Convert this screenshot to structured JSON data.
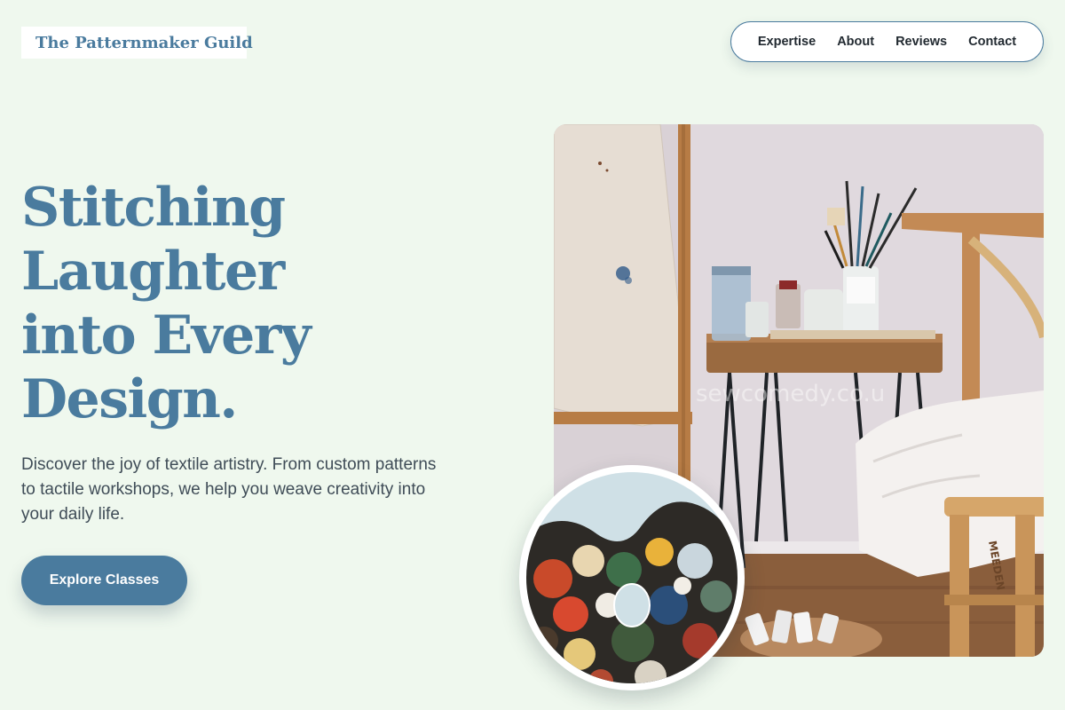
{
  "brand": {
    "name": "The Patternmaker Guild"
  },
  "nav": {
    "items": [
      {
        "label": "Expertise"
      },
      {
        "label": "About"
      },
      {
        "label": "Reviews"
      },
      {
        "label": "Contact"
      }
    ]
  },
  "hero": {
    "title_lines": [
      "Stitching",
      "Laughter",
      "into Every",
      "Design."
    ],
    "description": "Discover the joy of textile artistry. From custom patterns to tactile workshops, we help you weave creativity into your daily life.",
    "cta_label": "Explore Classes"
  },
  "images": {
    "main_alt": "Artist studio with paintbrushes on a small wooden table",
    "main_watermark": "sewcomedy.co.u",
    "stool_lettering": "MEEDEN",
    "palette_alt": "Paint palette covered in colorful paint"
  },
  "colors": {
    "background": "#eff8ee",
    "accent": "#4a7b9e",
    "text_dark": "#222a31",
    "text_body": "#3f4c57"
  }
}
